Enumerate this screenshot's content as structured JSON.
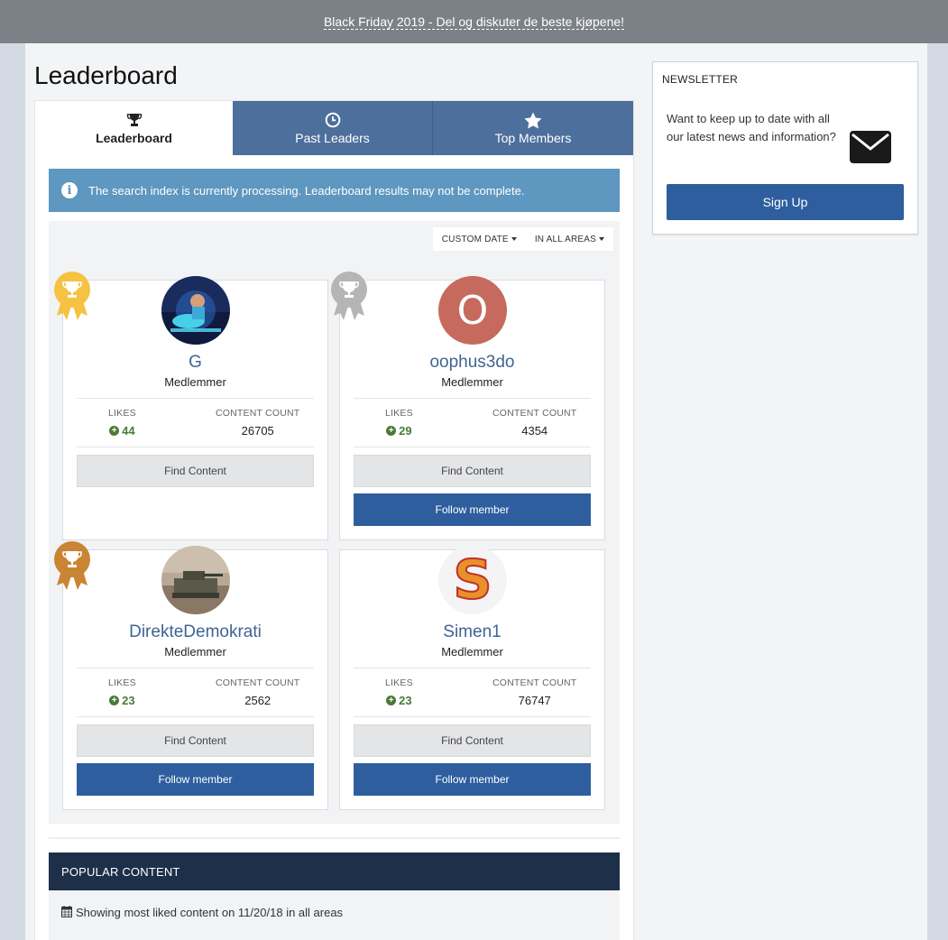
{
  "announcement": {
    "text": "Black Friday 2019 - Del og diskuter de beste kjøpene!"
  },
  "page_title": "Leaderboard",
  "tabs": [
    {
      "label": "Leaderboard",
      "icon": "trophy-icon",
      "active": true
    },
    {
      "label": "Past Leaders",
      "icon": "clock-icon",
      "active": false
    },
    {
      "label": "Top Members",
      "icon": "star-icon",
      "active": false
    }
  ],
  "notice": {
    "text": "The search index is currently processing. Leaderboard results may not be complete.",
    "icon": "info-icon"
  },
  "filters": {
    "date": "CUSTOM DATE",
    "area": "IN ALL AREAS"
  },
  "labels": {
    "likes": "LIKES",
    "content_count": "CONTENT COUNT",
    "find_content": "Find Content",
    "follow_member": "Follow member"
  },
  "members": [
    {
      "rank": 1,
      "medal": "gold",
      "name": "G",
      "group": "Medlemmer",
      "likes": "44",
      "content_count": "26705",
      "can_follow": false
    },
    {
      "rank": 2,
      "medal": "silver",
      "name": "oophus3do",
      "group": "Medlemmer",
      "likes": "29",
      "content_count": "4354",
      "can_follow": true,
      "avatar_letter": "O"
    },
    {
      "rank": 3,
      "medal": "bronze",
      "name": "DirekteDemokrati",
      "group": "Medlemmer",
      "likes": "23",
      "content_count": "2562",
      "can_follow": true
    },
    {
      "rank": 4,
      "medal": "none",
      "name": "Simen1",
      "group": "Medlemmer",
      "likes": "23",
      "content_count": "76747",
      "can_follow": true,
      "avatar_letter": "S"
    }
  ],
  "popular": {
    "heading": "POPULAR CONTENT",
    "showing": "Showing most liked content on 11/20/18 in all areas"
  },
  "sidebar": {
    "title": "NEWSLETTER",
    "text": "Want to keep up to date with all our latest news and information?",
    "button": "Sign Up"
  },
  "colors": {
    "accent": "#2e5e9e",
    "tab_bg": "#4d6f9c",
    "notice_bg": "#5e97bf",
    "popular_bg": "#1e2f49",
    "gold": "#f5c242",
    "silver": "#b5b5b5",
    "bronze": "#c98434",
    "likes_green": "#4a7a36"
  }
}
